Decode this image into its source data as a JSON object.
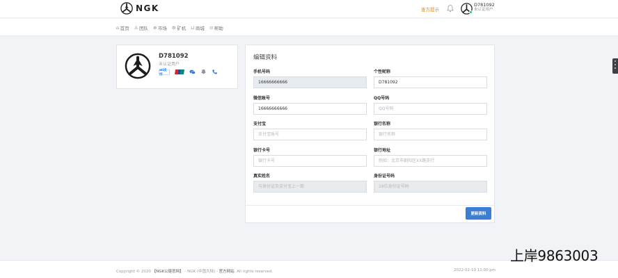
{
  "brand": {
    "name": "NGK"
  },
  "header": {
    "guide_link": "查方提示",
    "user_id": "D781092",
    "user_status": "未认证用户"
  },
  "nav": {
    "items": [
      {
        "label": "首页",
        "icon": "home-icon"
      },
      {
        "label": "团队",
        "icon": "team-icon"
      },
      {
        "label": "市场",
        "icon": "globe-icon"
      },
      {
        "label": "矿机",
        "icon": "gear-icon"
      },
      {
        "label": "商城",
        "icon": "cart-icon"
      },
      {
        "label": "帮助",
        "icon": "help-icon"
      }
    ]
  },
  "profile": {
    "name": "D781092",
    "status": "未认证用户",
    "badges": {
      "alipay": "ali支付",
      "unionpay": "unionpay-icon",
      "wechat": "wechat-icon",
      "qq": "qq-icon",
      "phone": "phone-icon"
    }
  },
  "form": {
    "title": "编辑资料",
    "fields": {
      "phone": {
        "label": "手机号码",
        "value": "16666666666",
        "placeholder": ""
      },
      "nickname": {
        "label": "个性昵称",
        "value": "D781092",
        "placeholder": ""
      },
      "wechat": {
        "label": "微信账号",
        "value": "16666666666",
        "placeholder": ""
      },
      "qq": {
        "label": "QQ号码",
        "value": "",
        "placeholder": "QQ号码"
      },
      "alipay": {
        "label": "支付宝",
        "value": "",
        "placeholder": "支付宝账号"
      },
      "bank_name": {
        "label": "银行名称",
        "value": "",
        "placeholder": "银行名称"
      },
      "bank_card": {
        "label": "银行卡号",
        "value": "",
        "placeholder": "银行卡号"
      },
      "bank_address": {
        "label": "银行地址",
        "value": "",
        "placeholder": "例如：北京市朝阳区XX路支行"
      },
      "real_name": {
        "label": "真实姓名",
        "value": "",
        "placeholder": "与身份证及支付宝上一致"
      },
      "id_number": {
        "label": "身份证号码",
        "value": "",
        "placeholder": "18位身份证号码"
      }
    },
    "submit_label": "更新资料"
  },
  "footer": {
    "copyright_prefix": "Copyright © 2020",
    "company": "【NGK公链官网】",
    "middle": "- NGK (中国大陆) -",
    "official": "官方网站",
    "suffix": ". All rights reserved.",
    "datetime": "2022-02-10 11:00 pm"
  },
  "watermark": "上岸9863003",
  "colors": {
    "accent": "#3b7fd4",
    "guide": "#e08a1e",
    "online": "#2fbf71",
    "background": "#f1f3f6"
  }
}
